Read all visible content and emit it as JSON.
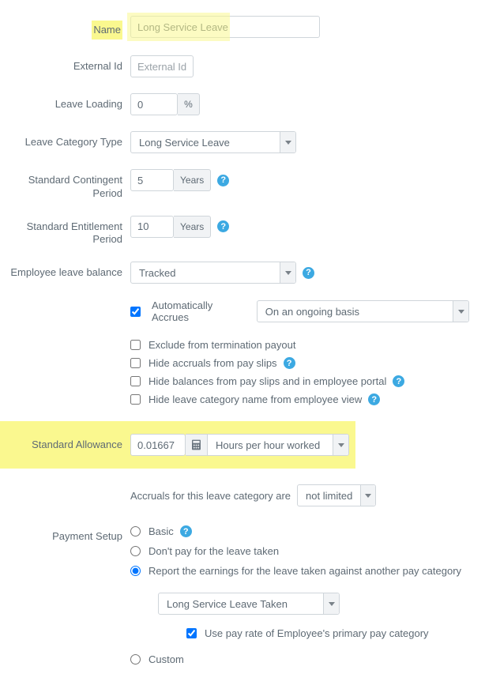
{
  "labels": {
    "name": "Name",
    "external_id": "External Id",
    "leave_loading": "Leave Loading",
    "leave_category_type": "Leave Category Type",
    "standard_contingent_period": "Standard Contingent Period",
    "standard_entitlement_period": "Standard Entitlement Period",
    "employee_leave_balance": "Employee leave balance",
    "standard_allowance": "Standard Allowance",
    "payment_setup": "Payment Setup"
  },
  "values": {
    "name": "Long Service Leave",
    "external_id": "",
    "external_id_placeholder": "External Id",
    "leave_loading": "0",
    "leave_category_type": "Long Service Leave",
    "standard_contingent_period": "5",
    "standard_entitlement_period": "10",
    "employee_leave_balance": "Tracked",
    "standard_allowance": "0.01667",
    "accrual_period": "On an ongoing basis",
    "accrual_limit": "not limited",
    "standard_allowance_unit": "Hours per hour worked",
    "report_category": "Long Service Leave Taken"
  },
  "units": {
    "percent": "%",
    "years": "Years"
  },
  "auto_accrues": {
    "label": "Automatically Accrues",
    "checked": true
  },
  "checkboxes": {
    "exclude_termination": {
      "label": "Exclude from termination payout",
      "checked": false
    },
    "hide_accruals": {
      "label": "Hide accruals from pay slips",
      "checked": false,
      "help": true
    },
    "hide_balances": {
      "label": "Hide balances from pay slips and in employee portal",
      "checked": false,
      "help": true
    },
    "hide_category_name": {
      "label": "Hide leave category name from employee view",
      "checked": false,
      "help": true
    }
  },
  "accrual_text": "Accruals for this leave category are",
  "payment": {
    "basic": {
      "label": "Basic",
      "checked": false,
      "help": true
    },
    "dont_pay": {
      "label": "Don't pay for the leave taken",
      "checked": false
    },
    "report": {
      "label": "Report the earnings for the leave taken against another pay category",
      "checked": true
    },
    "use_primary": {
      "label": "Use pay rate of Employee's primary pay category",
      "checked": true
    },
    "custom": {
      "label": "Custom",
      "checked": false
    }
  },
  "icons": {
    "help_char": "?",
    "caret_svg": "caret",
    "calc_svg": "calc"
  }
}
